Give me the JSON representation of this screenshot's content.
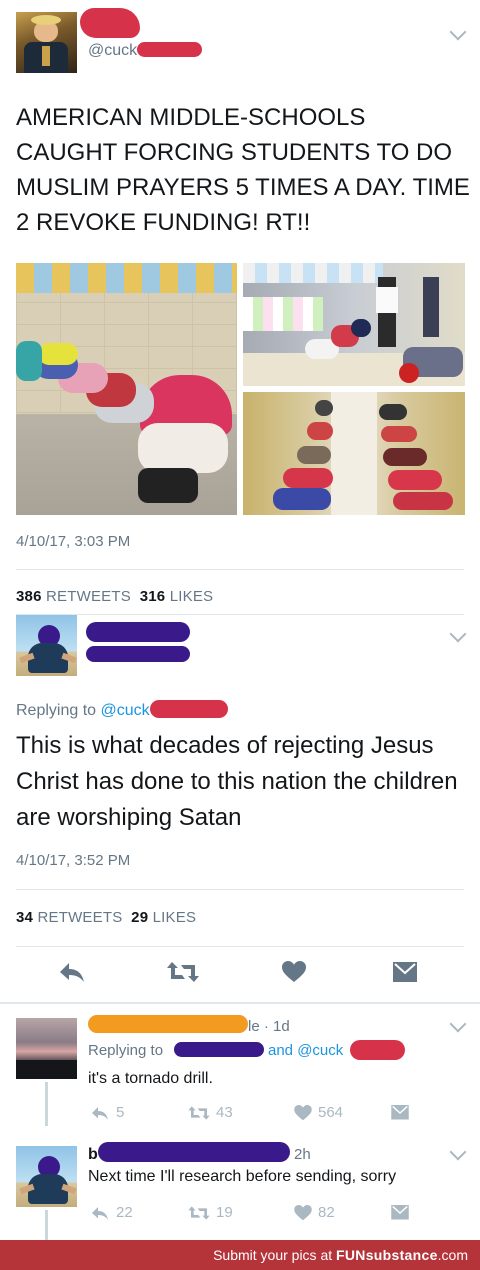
{
  "tweet1": {
    "handle": "@cuck",
    "text": "AMERICAN MIDDLE-SCHOOLS CAUGHT FORCING STUDENTS TO DO MUSLIM PRAYERS 5 TIMES A DAY. TIME 2 REVOKE FUNDING! RT!!",
    "timestamp": "4/10/17, 3:03 PM",
    "retweets": "386",
    "retweets_label": "RETWEETS",
    "likes": "316",
    "likes_label": "LIKES"
  },
  "tweet2": {
    "replying_prefix": "Replying to",
    "replying_handle": "@cuck",
    "text": "This is what decades of rejecting Jesus Christ has done to this nation the children are worshiping Satan",
    "timestamp": "4/10/17, 3:52 PM",
    "retweets": "34",
    "retweets_label": "RETWEETS",
    "likes": "29",
    "likes_label": "LIKES"
  },
  "actions": {
    "icons": [
      "reply-icon",
      "retweet-icon",
      "heart-icon",
      "dm-icon"
    ]
  },
  "reply1": {
    "name_partial": "le",
    "time": "· 1d",
    "replying_prefix": "Replying to",
    "replying_mid": "and @cuck",
    "text": "it's a tornado drill.",
    "replies": "5",
    "retweets": "43",
    "likes": "564"
  },
  "reply2": {
    "name_partial": "b",
    "time": "2h",
    "text": "Next time I'll research before sending, sorry",
    "replies": "22",
    "retweets": "19",
    "likes": "82"
  },
  "footer": {
    "prefix": "Submit your pics at",
    "brand": "FUNsubstance",
    "suffix": ".com"
  },
  "colors": {
    "redaction_red": "#d6334a",
    "redaction_purple": "#3a1a8a",
    "redaction_orange": "#f39a20",
    "link_blue": "#1b95e0",
    "footer_red": "#b5343a"
  }
}
